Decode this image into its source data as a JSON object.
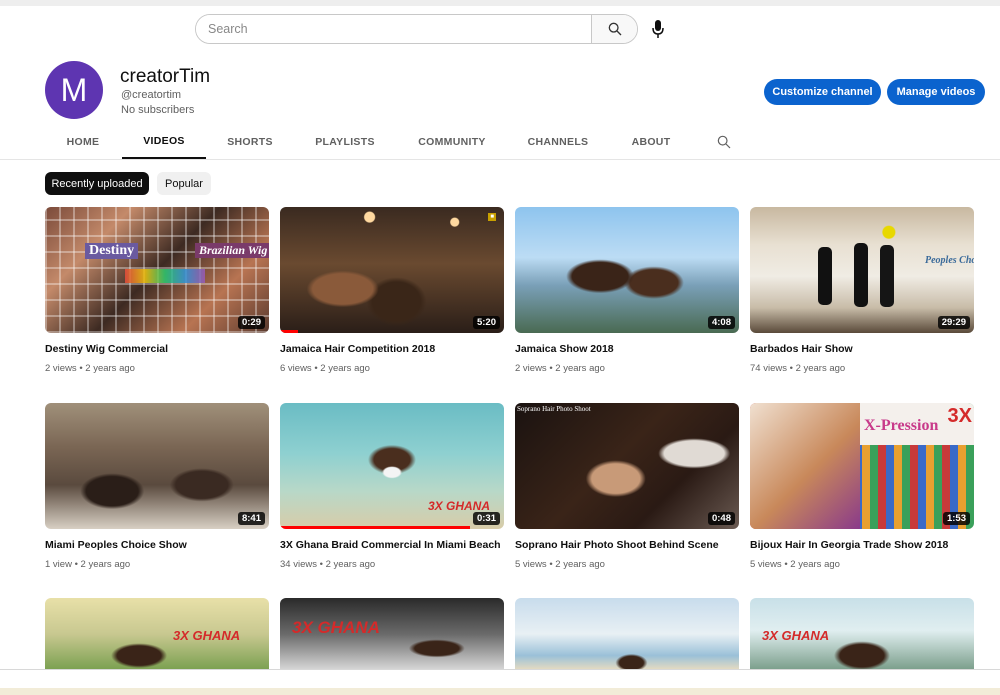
{
  "search": {
    "placeholder": "Search"
  },
  "channel": {
    "avatar_letter": "M",
    "name": "creatorTim",
    "handle": "@creatortim",
    "subscribers": "No subscribers",
    "customize_label": "Customize channel",
    "manage_label": "Manage videos"
  },
  "tabs": [
    "HOME",
    "VIDEOS",
    "SHORTS",
    "PLAYLISTS",
    "COMMUNITY",
    "CHANNELS",
    "ABOUT"
  ],
  "active_tab": "VIDEOS",
  "chips": {
    "recent": "Recently uploaded",
    "popular": "Popular"
  },
  "thumb_text": {
    "destiny": "Destiny",
    "brazilian": "Brazilian Wig",
    "ghana": "3X GHANA",
    "xpression": "X-Pression",
    "soprano": "Soprano Hair Photo Shoot",
    "peoples": "Peoples Choice"
  },
  "videos": [
    {
      "title": "Destiny Wig Commercial",
      "meta": "2 views • 2 years ago",
      "duration": "0:29"
    },
    {
      "title": "Jamaica Hair Competition 2018",
      "meta": "6 views • 2 years ago",
      "duration": "5:20"
    },
    {
      "title": "Jamaica Show 2018",
      "meta": "2 views • 2 years ago",
      "duration": "4:08"
    },
    {
      "title": "Barbados Hair Show",
      "meta": "74 views • 2 years ago",
      "duration": "29:29"
    },
    {
      "title": "Miami Peoples Choice Show",
      "meta": "1 view • 2 years ago",
      "duration": "8:41"
    },
    {
      "title": "3X Ghana Braid Commercial In Miami Beach",
      "meta": "34 views • 2 years ago",
      "duration": "0:31"
    },
    {
      "title": "Soprano Hair Photo Shoot Behind Scene",
      "meta": "5 views • 2 years ago",
      "duration": "0:48"
    },
    {
      "title": "Bijoux Hair In Georgia Trade Show 2018",
      "meta": "5 views • 2 years ago",
      "duration": "1:53"
    }
  ],
  "colors": {
    "accent": "#0b63ce",
    "avatar": "#5e35b1",
    "progress": "#ff0000",
    "active_chip": "#0f0f0f"
  },
  "icons": [
    "search-icon",
    "microphone-icon",
    "tab-search-icon"
  ]
}
